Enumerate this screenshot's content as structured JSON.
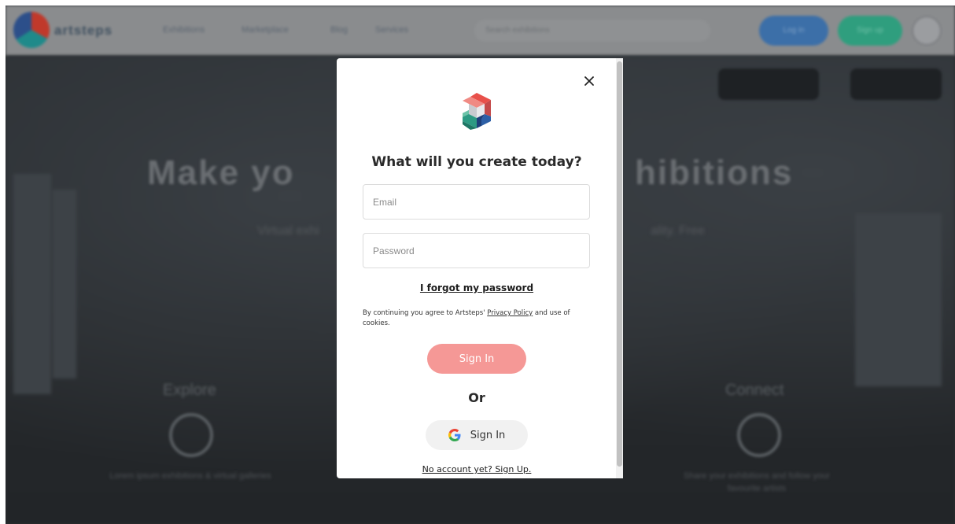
{
  "background": {
    "logo_text": "artsteps",
    "nav": [
      "Exhibitions",
      "Marketplace",
      "Blog",
      "Services"
    ],
    "search_placeholder": "Search exhibitions",
    "login_label": "Log in",
    "signup_label": "Sign up",
    "hero_title_left": "Make yo",
    "hero_title_right": "hibitions",
    "hero_sub_left": "Virtual exhi",
    "hero_sub_right": "ality. Free",
    "sections": [
      {
        "label": "Explore",
        "text": "Lorem ipsum exhibitions & virtual galleries"
      },
      {
        "label": "Connect",
        "text": "Share your exhibitions and follow your favourite artists"
      }
    ]
  },
  "modal": {
    "title": "What will you create today?",
    "email_placeholder": "Email",
    "password_placeholder": "Password",
    "forgot_password": "I forgot my password",
    "consent_prefix": "By continuing you agree to Artsteps'",
    "privacy_policy": "Privacy Policy",
    "consent_suffix": "and use of cookies.",
    "signin_label": "Sign In",
    "or_label": "Or",
    "google_signin_label": "Sign In",
    "signup_link": "No account yet? Sign Up.",
    "colors": {
      "signin_button": "#f59896",
      "google_button": "#f1f1f1"
    }
  }
}
